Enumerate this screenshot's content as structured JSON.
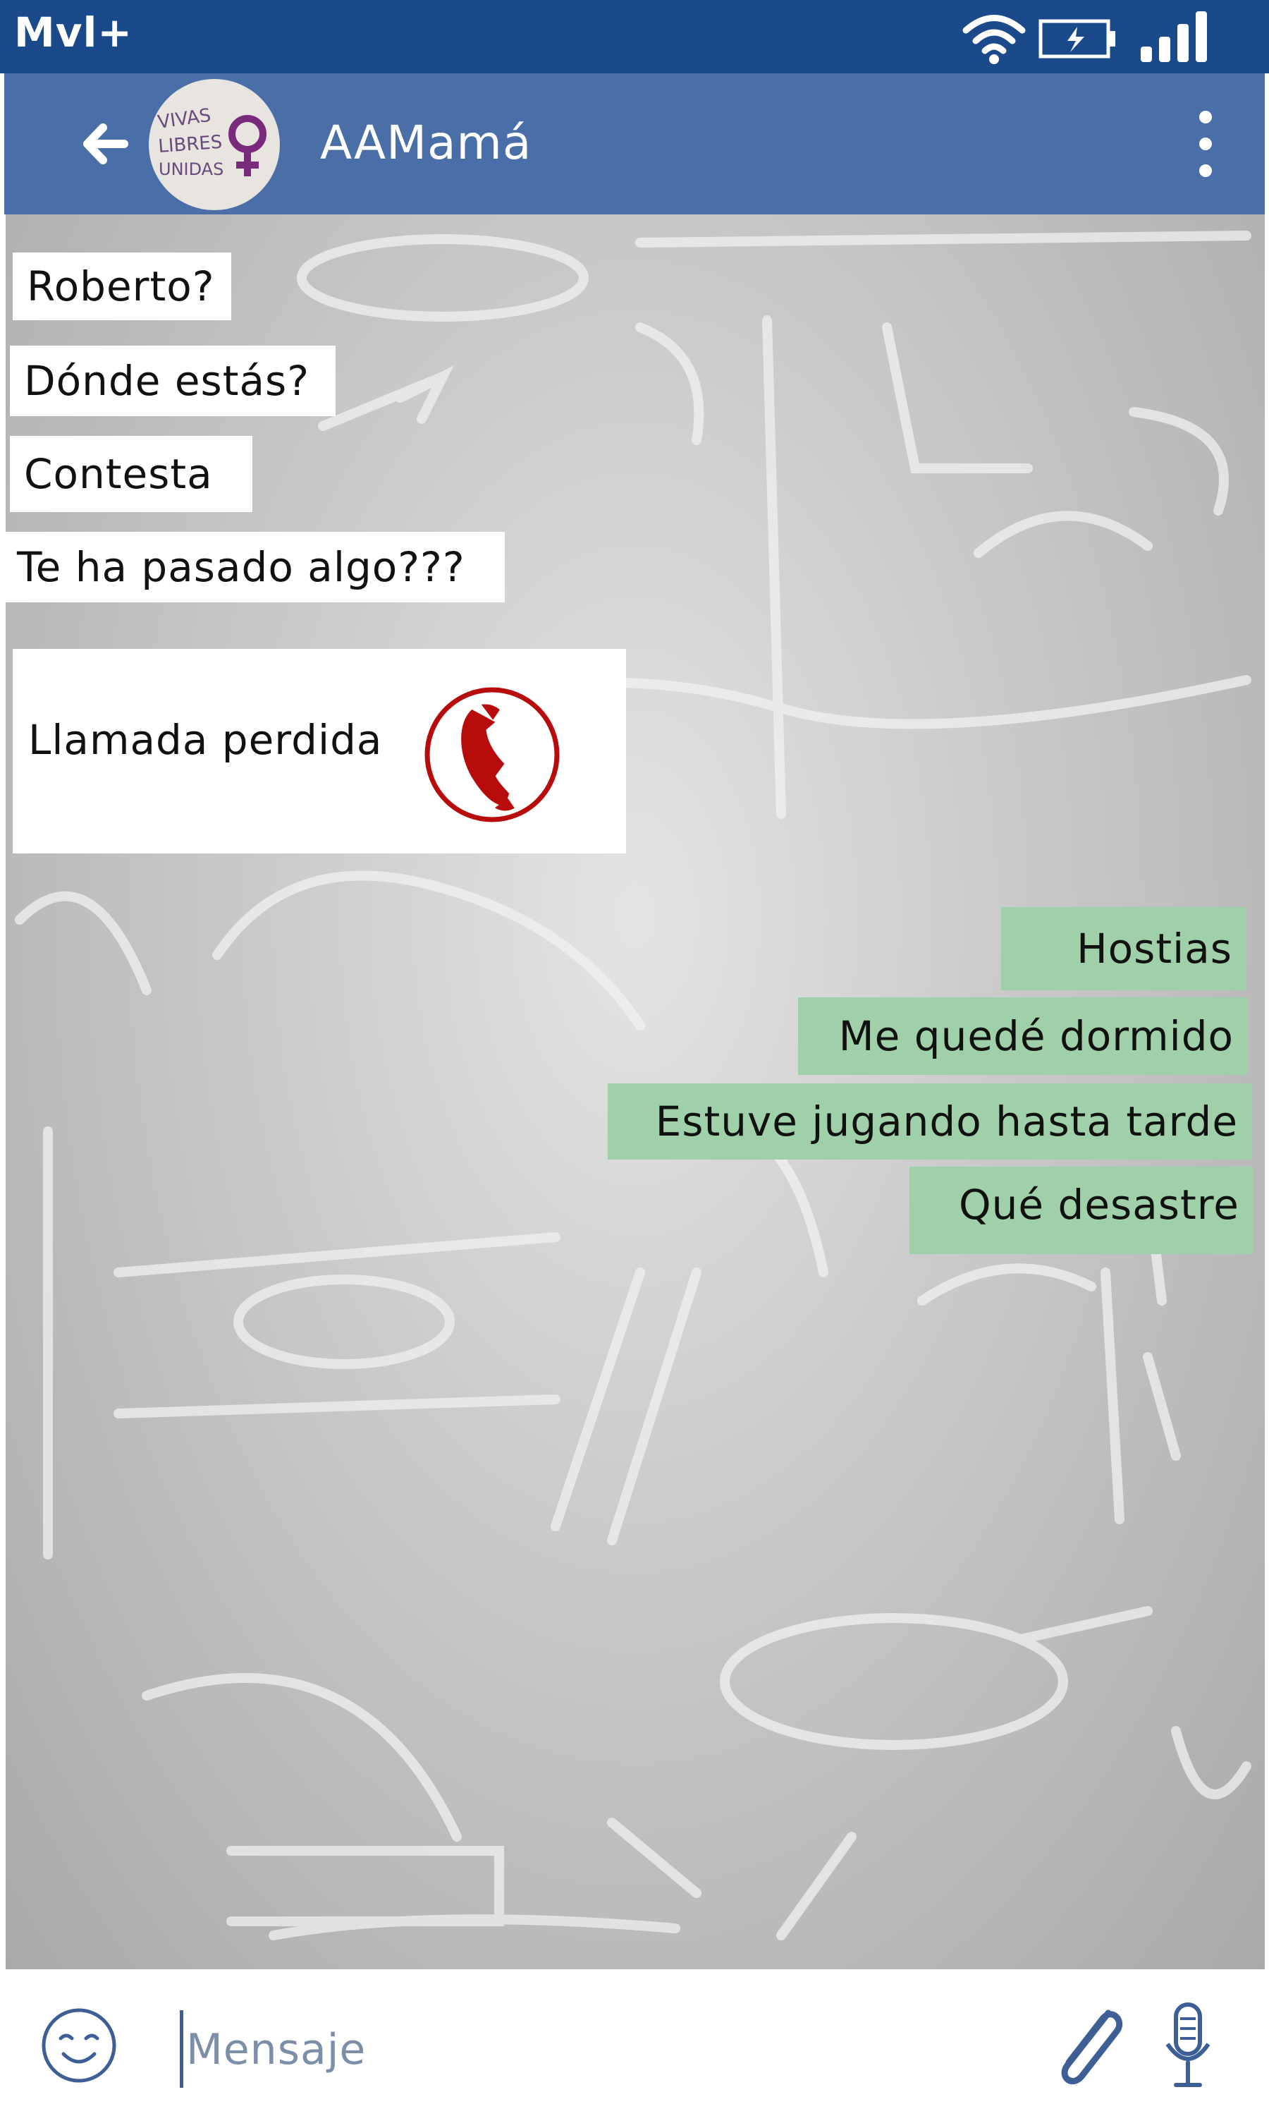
{
  "status_bar": {
    "carrier": "Mvl+",
    "icons": [
      "wifi-icon",
      "battery-charging-icon",
      "signal-icon"
    ]
  },
  "app_bar": {
    "title": "AAMamá",
    "avatar_lines": [
      "VIVAS",
      "LIBRES",
      "UNIDAS"
    ],
    "icons": [
      "back-arrow-icon",
      "more-vert-icon"
    ]
  },
  "messages": [
    {
      "direction": "in",
      "text": "Roberto?"
    },
    {
      "direction": "in",
      "text": "Dónde estás?"
    },
    {
      "direction": "in",
      "text": "Contesta"
    },
    {
      "direction": "in",
      "text": "Te ha pasado algo???"
    },
    {
      "direction": "in",
      "text": "Llamada perdida",
      "icon": "missed-call-phone-icon"
    },
    {
      "direction": "out",
      "text": "Hostias"
    },
    {
      "direction": "out",
      "text": "Me quedé dormido"
    },
    {
      "direction": "out",
      "text": "Estuve jugando hasta tarde"
    },
    {
      "direction": "out",
      "text": "Qué desastre"
    }
  ],
  "input_bar": {
    "placeholder": "Mensaje",
    "icons": [
      "emoji-icon",
      "paperclip-icon",
      "microphone-icon"
    ]
  },
  "colors": {
    "status_bar": "#1a4a8a",
    "app_bar": "#4a6fa8",
    "outgoing_bubble": "#9fd0a9",
    "incoming_bubble": "#ffffff",
    "missed_call": "#b80c0c",
    "icon_blue": "#3d5f96"
  }
}
